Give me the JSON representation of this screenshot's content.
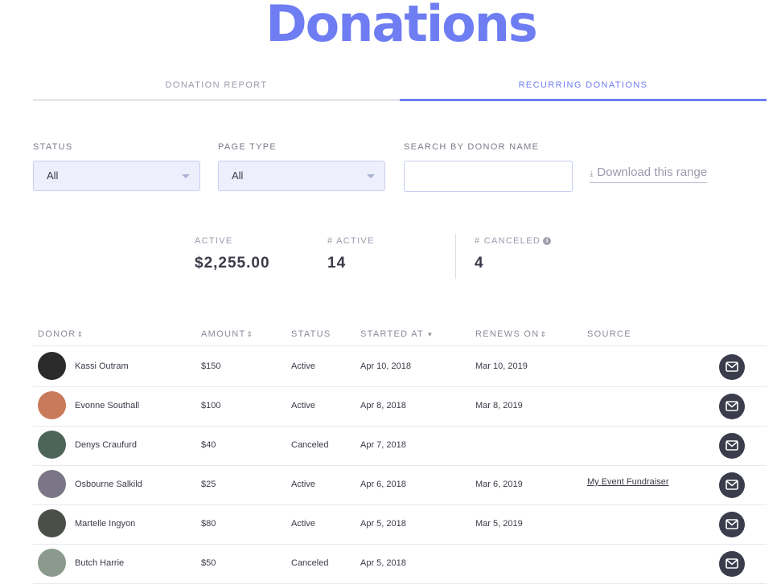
{
  "page": {
    "title": "Donations"
  },
  "tabs": [
    {
      "label": "DONATION REPORT",
      "active": false
    },
    {
      "label": "RECURRING DONATIONS",
      "active": true
    }
  ],
  "filters": {
    "status": {
      "label": "STATUS",
      "value": "All"
    },
    "page_type": {
      "label": "PAGE TYPE",
      "value": "All"
    },
    "search": {
      "label": "SEARCH BY DONOR NAME",
      "value": ""
    },
    "download": {
      "label": "Download this range",
      "icon": "download-icon"
    }
  },
  "stats": [
    {
      "label": "ACTIVE",
      "value": "$2,255.00"
    },
    {
      "label": "# ACTIVE",
      "value": "14"
    },
    {
      "label": "# CANCELED",
      "value": "4",
      "icon": "info-icon"
    }
  ],
  "table": {
    "columns": [
      {
        "label": "DONOR",
        "sort": "⇕"
      },
      {
        "label": "AMOUNT",
        "sort": "⇕"
      },
      {
        "label": "STATUS",
        "sort": ""
      },
      {
        "label": "STARTED AT",
        "sort": "▾"
      },
      {
        "label": "RENEWS ON",
        "sort": "⇕"
      },
      {
        "label": "SOURCE",
        "sort": ""
      }
    ],
    "rows": [
      {
        "donor": "Kassi Outram",
        "amount": "$150",
        "status": "Active",
        "started": "Apr 10, 2018",
        "renews": "Mar 10, 2019",
        "source": "",
        "avatar": "#2a2a2a"
      },
      {
        "donor": "Evonne Southall",
        "amount": "$100",
        "status": "Active",
        "started": "Apr 8, 2018",
        "renews": "Mar 8, 2019",
        "source": "",
        "avatar": "#c97a5a"
      },
      {
        "donor": "Denys Craufurd",
        "amount": "$40",
        "status": "Canceled",
        "started": "Apr 7, 2018",
        "renews": "",
        "source": "",
        "avatar": "#4d6558"
      },
      {
        "donor": "Osbourne Salkild",
        "amount": "$25",
        "status": "Active",
        "started": "Apr 6, 2018",
        "renews": "Mar 6, 2019",
        "source": "My Event Fundraiser",
        "avatar": "#7a7688"
      },
      {
        "donor": "Martelle Ingyon",
        "amount": "$80",
        "status": "Active",
        "started": "Apr 5, 2018",
        "renews": "Mar 5, 2019",
        "source": "",
        "avatar": "#4a5048"
      },
      {
        "donor": "Butch Harrie",
        "amount": "$50",
        "status": "Canceled",
        "started": "Apr 5, 2018",
        "renews": "",
        "source": "",
        "avatar": "#8a9a8c"
      }
    ],
    "row_action_icon": "mail-icon"
  },
  "colors": {
    "accent": "#6e7df2",
    "text": "#3a3a48",
    "muted": "#9a9aae",
    "button": "#3b3c4c"
  }
}
